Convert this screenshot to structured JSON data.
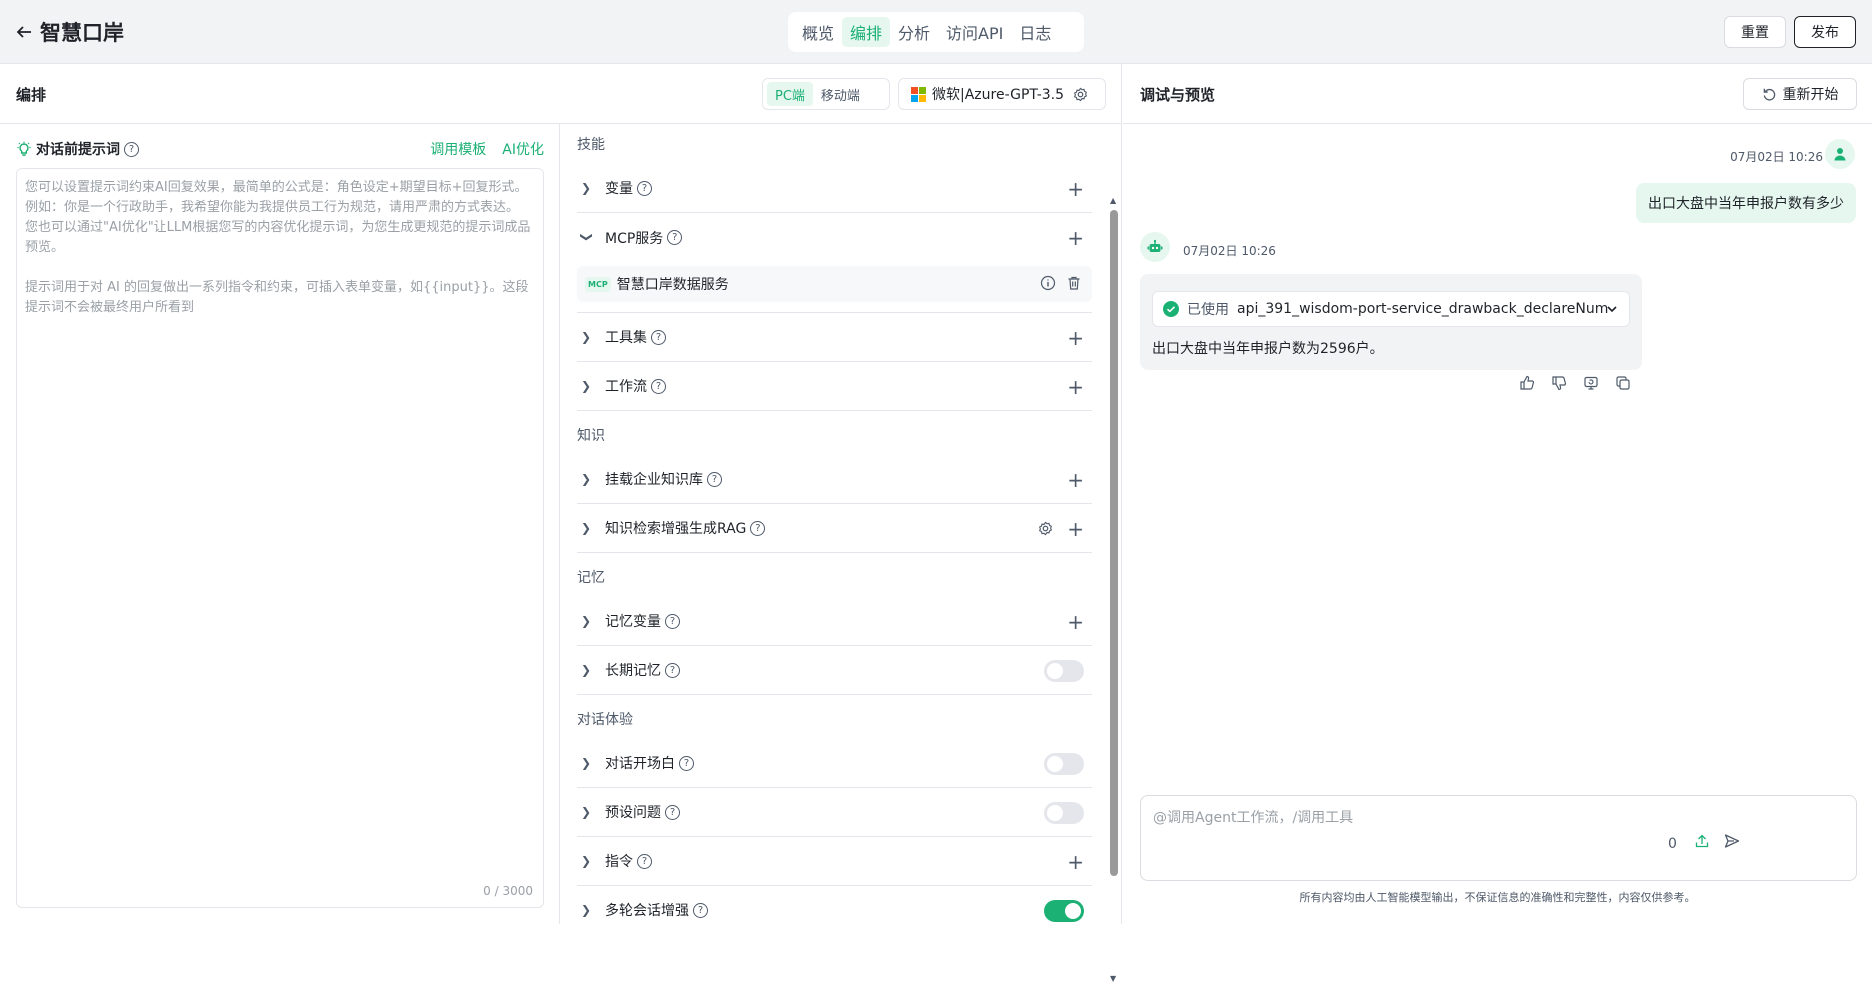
{
  "app": {
    "title": "智慧口岸"
  },
  "top_tabs": [
    {
      "label": "概览",
      "active": false
    },
    {
      "label": "编排",
      "active": true
    },
    {
      "label": "分析",
      "active": false
    },
    {
      "label": "访问API",
      "active": false
    },
    {
      "label": "日志",
      "active": false
    }
  ],
  "top_buttons": {
    "reset": "重置",
    "publish": "发布"
  },
  "left": {
    "title": "编排",
    "device_tabs": [
      {
        "label": "PC端",
        "active": true
      },
      {
        "label": "移动端",
        "active": false
      }
    ],
    "model_name": "微软|Azure-GPT-3.5",
    "prompt": {
      "label": "对话前提示词",
      "link_template": "调用模板",
      "link_ai": "AI优化",
      "placeholder": "您可以设置提示词约束AI回复效果，最简单的公式是：角色设定+期望目标+回复形式。例如：你是一个行政助手，我希望你能为我提供员工行为规范，请用严肃的方式表达。 您也可以通过\"AI优化\"让LLM根据您写的内容优化提示词，为您生成更规范的提示词成品预览。\n\n提示词用于对 AI 的回复做出一系列指令和约束，可插入表单变量，如{{input}}。这段提示词不会被最终用户所看到",
      "count": "0 / 3000"
    },
    "sections": {
      "skills": "技能",
      "knowledge": "知识",
      "memory": "记忆",
      "experience": "对话体验"
    },
    "skills": {
      "variables": "变量",
      "mcp": "MCP服务",
      "mcp_item": {
        "badge": "MCP",
        "name": "智慧口岸数据服务"
      },
      "toolset": "工具集",
      "workflow": "工作流"
    },
    "knowledge": {
      "kb": "挂载企业知识库",
      "rag": "知识检索增强生成RAG"
    },
    "memory": {
      "vars": "记忆变量",
      "long_term": "长期记忆",
      "long_term_on": false
    },
    "experience": {
      "opening": "对话开场白",
      "opening_on": false,
      "preset": "预设问题",
      "preset_on": false,
      "commands": "指令",
      "multi_turn": "多轮会话增强",
      "multi_turn_on": true
    }
  },
  "right": {
    "title": "调试与预览",
    "restart": "重新开始",
    "user_msg": {
      "time": "07月02日 10:26",
      "text": "出口大盘中当年申报户数有多少"
    },
    "bot_msg": {
      "time": "07月02日 10:26",
      "used_label": "已使用",
      "tool_name": "api_391_wisdom-port-service_drawback_declareNum",
      "answer": "出口大盘中当年申报户数为2596户。"
    },
    "input": {
      "placeholder": "@调用Agent工作流，/调用工具",
      "count": "0"
    },
    "disclaimer": "所有内容均由人工智能模型输出，不保证信息的准确性和完整性，内容仅供参考。"
  },
  "colors": {
    "accent": "#1bb074",
    "accent_bg": "#e6f7ef"
  }
}
